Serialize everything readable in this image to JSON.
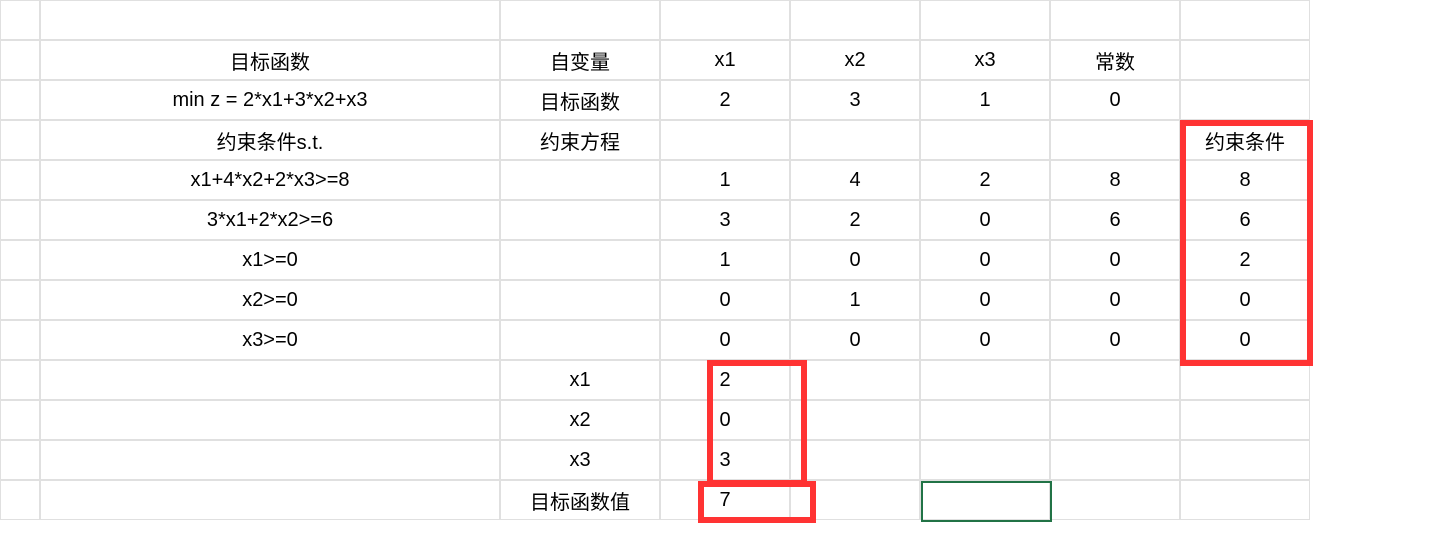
{
  "rows": [
    [
      "",
      "",
      "",
      "",
      "",
      "",
      "",
      ""
    ],
    [
      "",
      "目标函数",
      "自变量",
      "x1",
      "x2",
      "x3",
      "常数",
      ""
    ],
    [
      "",
      "min z = 2*x1+3*x2+x3",
      "目标函数",
      "2",
      "3",
      "1",
      "0",
      ""
    ],
    [
      "",
      "约束条件s.t.",
      "约束方程",
      "",
      "",
      "",
      "",
      "约束条件"
    ],
    [
      "",
      "x1+4*x2+2*x3>=8",
      "",
      "1",
      "4",
      "2",
      "8",
      "8"
    ],
    [
      "",
      "3*x1+2*x2>=6",
      "",
      "3",
      "2",
      "0",
      "6",
      "6"
    ],
    [
      "",
      "x1>=0",
      "",
      "1",
      "0",
      "0",
      "0",
      "2"
    ],
    [
      "",
      "x2>=0",
      "",
      "0",
      "1",
      "0",
      "0",
      "0"
    ],
    [
      "",
      "x3>=0",
      "",
      "0",
      "0",
      "0",
      "0",
      "0"
    ],
    [
      "",
      "",
      "x1",
      "2",
      "",
      "",
      "",
      ""
    ],
    [
      "",
      "",
      "x2",
      "0",
      "",
      "",
      "",
      ""
    ],
    [
      "",
      "",
      "x3",
      "3",
      "",
      "",
      "",
      ""
    ],
    [
      "",
      "",
      "目标函数值",
      "7",
      "",
      "",
      "",
      ""
    ]
  ]
}
